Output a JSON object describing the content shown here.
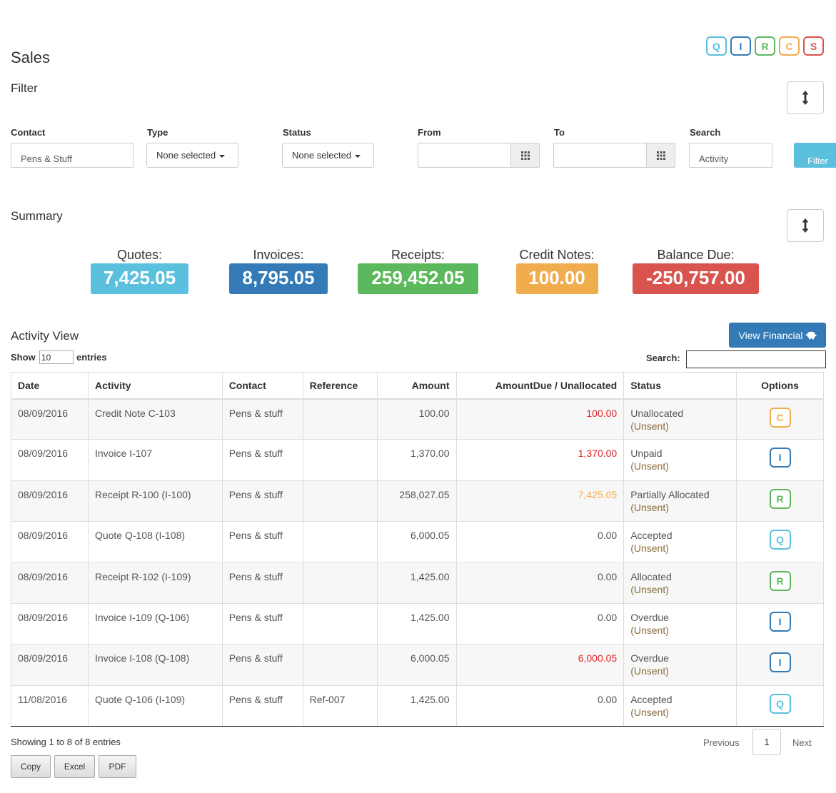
{
  "type_badges": [
    {
      "letter": "Q",
      "color": "#5bc0de"
    },
    {
      "letter": "I",
      "color": "#337ab7"
    },
    {
      "letter": "R",
      "color": "#5cb85c"
    },
    {
      "letter": "C",
      "color": "#f0ad4e"
    },
    {
      "letter": "S",
      "color": "#d9534f"
    }
  ],
  "page_title": "Sales",
  "filter": {
    "title": "Filter",
    "contact_label": "Contact",
    "contact_value": "Pens & Stuff",
    "type_label": "Type",
    "type_value": "None selected",
    "status_label": "Status",
    "status_value": "None selected",
    "from_label": "From",
    "to_label": "To",
    "search_label": "Search",
    "search_placeholder": "Activity",
    "filter_button": "Filter"
  },
  "summary": {
    "title": "Summary",
    "items": [
      {
        "label": "Quotes:",
        "value": "7,425.05",
        "color": "#5bc0de"
      },
      {
        "label": "Invoices:",
        "value": "8,795.05",
        "color": "#337ab7"
      },
      {
        "label": "Receipts:",
        "value": "259,452.05",
        "color": "#5cb85c"
      },
      {
        "label": "Credit Notes:",
        "value": "100.00",
        "color": "#f0ad4e"
      },
      {
        "label": "Balance Due:",
        "value": "-250,757.00",
        "color": "#d9534f"
      }
    ]
  },
  "activity": {
    "title": "Activity View",
    "view_financial": "View Financial",
    "show_label": "Show",
    "show_value": "10",
    "entries_label": "entries",
    "search_label": "Search:",
    "columns": [
      "Date",
      "Activity",
      "Contact",
      "Reference",
      "Amount",
      "AmountDue / Unallocated",
      "Status",
      "Options"
    ],
    "rows": [
      {
        "date": "08/09/2016",
        "activity": "Credit Note C-103",
        "contact": "Pens & stuff",
        "reference": "",
        "amount": "100.00",
        "due": "100.00",
        "due_color": "#e0262a",
        "status": "Unallocated",
        "status_sub": "(Unsent)",
        "option": "C",
        "option_color": "#f0ad4e"
      },
      {
        "date": "08/09/2016",
        "activity": "Invoice I-107",
        "contact": "Pens & stuff",
        "reference": "",
        "amount": "1,370.00",
        "due": "1,370.00",
        "due_color": "#e0262a",
        "status": "Unpaid",
        "status_sub": "(Unsent)",
        "option": "I",
        "option_color": "#337ab7"
      },
      {
        "date": "08/09/2016",
        "activity": "Receipt R-100 (I-100)",
        "contact": "Pens & stuff",
        "reference": "",
        "amount": "258,027.05",
        "due": "7,425.05",
        "due_color": "#f0ad4e",
        "status": "Partially Allocated",
        "status_sub": "(Unsent)",
        "option": "R",
        "option_color": "#5cb85c"
      },
      {
        "date": "08/09/2016",
        "activity": "Quote Q-108 (I-108)",
        "contact": "Pens & stuff",
        "reference": "",
        "amount": "6,000.05",
        "due": "0.00",
        "due_color": "#555555",
        "status": "Accepted",
        "status_sub": "(Unsent)",
        "option": "Q",
        "option_color": "#5bc0de"
      },
      {
        "date": "08/09/2016",
        "activity": "Receipt R-102 (I-109)",
        "contact": "Pens & stuff",
        "reference": "",
        "amount": "1,425.00",
        "due": "0.00",
        "due_color": "#555555",
        "status": "Allocated",
        "status_sub": "(Unsent)",
        "option": "R",
        "option_color": "#5cb85c"
      },
      {
        "date": "08/09/2016",
        "activity": "Invoice I-109 (Q-106)",
        "contact": "Pens & stuff",
        "reference": "",
        "amount": "1,425.00",
        "due": "0.00",
        "due_color": "#555555",
        "status": "Overdue",
        "status_sub": "(Unsent)",
        "option": "I",
        "option_color": "#337ab7"
      },
      {
        "date": "08/09/2016",
        "activity": "Invoice I-108 (Q-108)",
        "contact": "Pens & stuff",
        "reference": "",
        "amount": "6,000.05",
        "due": "6,000.05",
        "due_color": "#e0262a",
        "status": "Overdue",
        "status_sub": "(Unsent)",
        "option": "I",
        "option_color": "#337ab7"
      },
      {
        "date": "11/08/2016",
        "activity": "Quote Q-106 (I-109)",
        "contact": "Pens & stuff",
        "reference": "Ref-007",
        "amount": "1,425.00",
        "due": "0.00",
        "due_color": "#555555",
        "status": "Accepted",
        "status_sub": "(Unsent)",
        "option": "Q",
        "option_color": "#5bc0de"
      }
    ],
    "info": "Showing 1 to 8 of 8 entries",
    "pagination": {
      "previous": "Previous",
      "page": "1",
      "next": "Next"
    },
    "export_buttons": [
      "Copy",
      "Excel",
      "PDF"
    ]
  }
}
